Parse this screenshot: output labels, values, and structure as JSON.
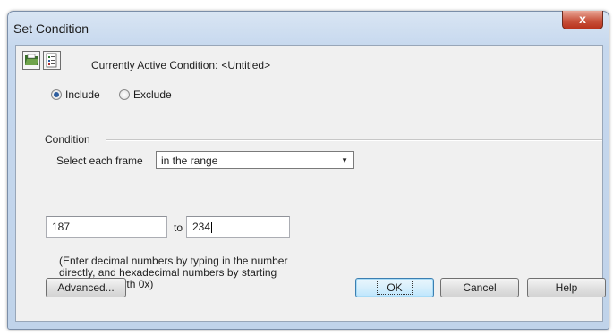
{
  "window": {
    "title": "Set Condition",
    "close_glyph": "x"
  },
  "toolbar": {
    "open_icon": "open-folder-icon",
    "save_icon": "save-condition-icon",
    "active_condition_label": "Currently Active Condition:",
    "active_condition_value": "<Untitled>"
  },
  "mode": {
    "selected": "Include",
    "include_label": "Include",
    "exclude_label": "Exclude"
  },
  "condition": {
    "group_label": "Condition",
    "select_label": "Select each frame",
    "select_value": "in the range",
    "from_value": "187",
    "to_label": "to",
    "to_value": "234",
    "hint": "(Enter decimal numbers by typing in the number\ndirectly, and hexadecimal numbers by starting\nthe number with 0x)"
  },
  "buttons": {
    "advanced": "Advanced...",
    "ok": "OK",
    "cancel": "Cancel",
    "help": "Help"
  },
  "colors": {
    "title_bar": "#c6d8ee",
    "close_button": "#c9533d",
    "dialog_face": "#f0f0f0",
    "default_button_border": "#3c7fb1"
  }
}
